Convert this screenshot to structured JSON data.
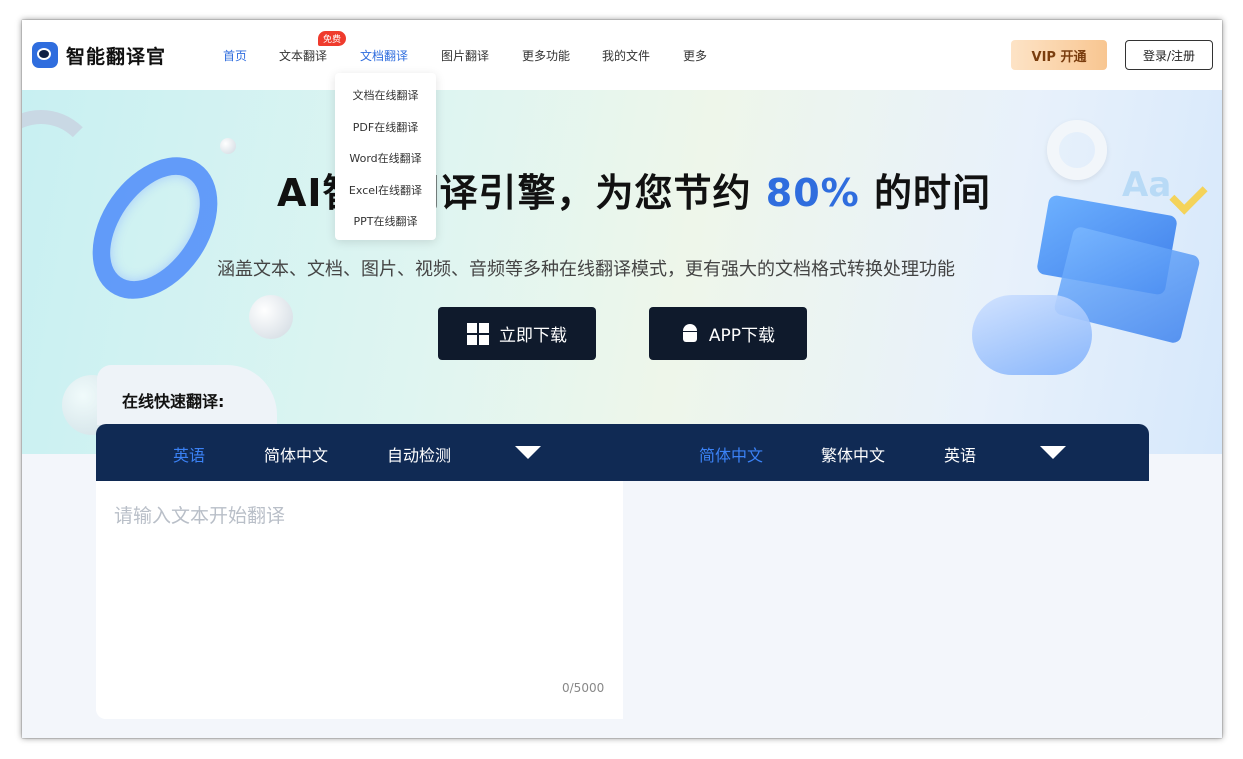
{
  "nav": {
    "brand": "智能翻译官",
    "items": [
      {
        "label": "首页"
      },
      {
        "label": "文本翻译"
      },
      {
        "label": "文档翻译"
      },
      {
        "label": "图片翻译"
      },
      {
        "label": "更多功能"
      },
      {
        "label": "我的文件"
      },
      {
        "label": "更多"
      }
    ],
    "badge": "免费",
    "vip_label": "VIP 开通",
    "login_label": "登录/注册"
  },
  "dropdown": {
    "items": [
      "文档在线翻译",
      "PDF在线翻译",
      "Word在线翻译",
      "Excel在线翻译",
      "PPT在线翻译"
    ]
  },
  "hero": {
    "title_prefix": "AI智能翻译引擎，为您节约",
    "title_highlight": "80%",
    "title_suffix": "的时间",
    "subtitle": "涵盖文本、文档、图片、视频、音频等多种在线翻译模式，更有强大的文档格式转换处理功能",
    "download_label": "立即下载",
    "app_label": "APP下载",
    "deco_text": "Aa"
  },
  "translator": {
    "heading": "在线快速翻译:",
    "source_langs": [
      "英语",
      "简体中文",
      "自动检测"
    ],
    "target_langs": [
      "简体中文",
      "繁体中文",
      "英语"
    ],
    "input_placeholder": "请输入文本开始翻译",
    "counter": "0/5000"
  },
  "colors": {
    "accent": "#2f6dde",
    "lang_bar": "#102a54",
    "button_dark": "#0f1a2c",
    "badge": "#ef3b2d"
  }
}
